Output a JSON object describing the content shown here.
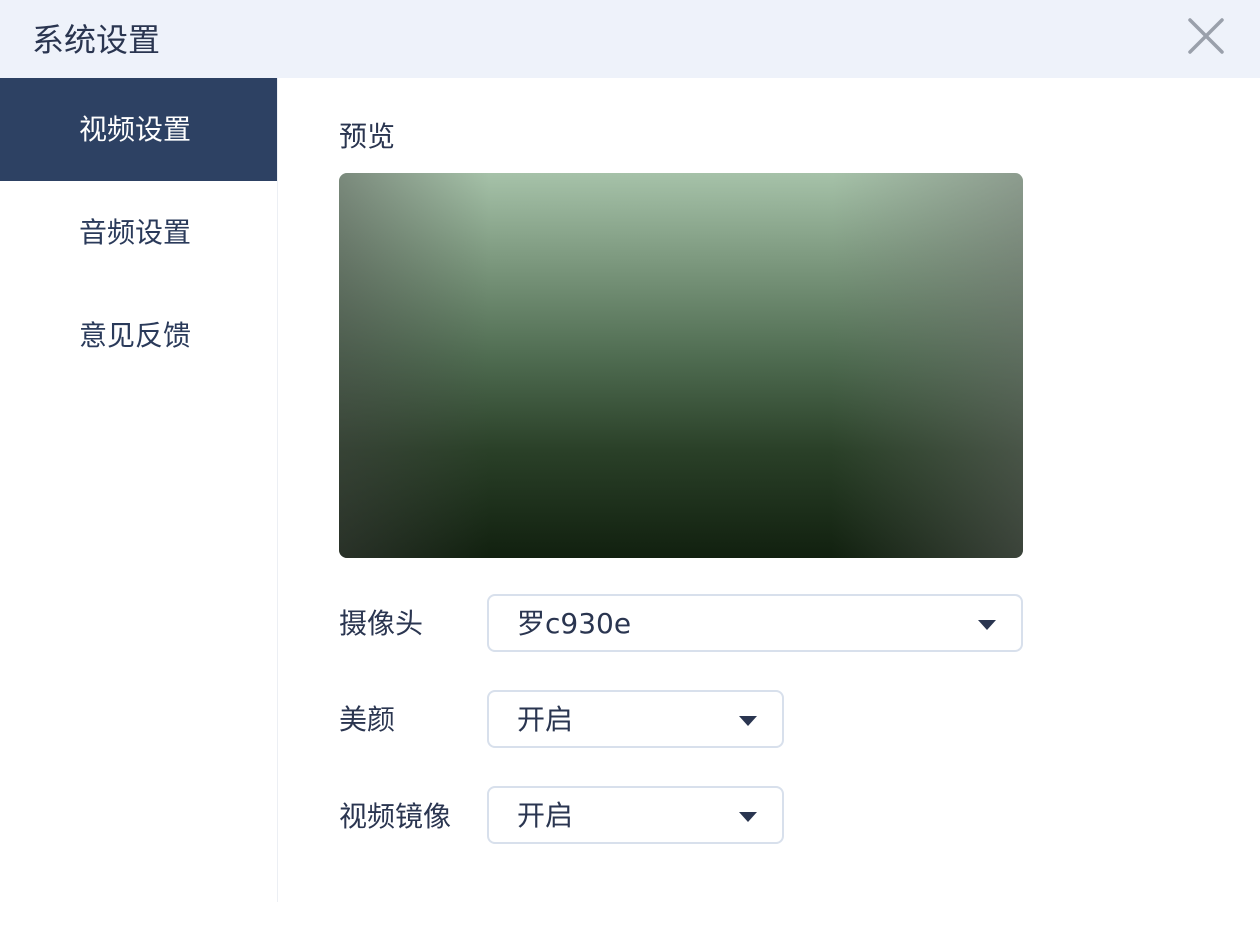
{
  "window": {
    "title": "系统设置",
    "close_icon": "close-icon"
  },
  "sidebar": {
    "items": [
      {
        "label": "视频设置",
        "active": true
      },
      {
        "label": "音频设置",
        "active": false
      },
      {
        "label": "意见反馈",
        "active": false
      }
    ]
  },
  "video": {
    "preview_label": "预览",
    "camera": {
      "label": "摄像头",
      "value": "罗c930e"
    },
    "beauty": {
      "label": "美颜",
      "value": "开启"
    },
    "mirror": {
      "label": "视频镜像",
      "value": "开启"
    }
  },
  "colors": {
    "sidebar_active": "#2d4163",
    "titlebar_bg": "#eef2fa",
    "text": "#2a3550"
  }
}
